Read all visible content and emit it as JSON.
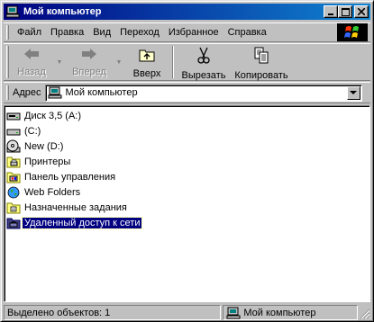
{
  "window": {
    "title": "Мой компьютер",
    "buttons": {
      "minimize": "_",
      "maximize": "□",
      "close": "×"
    }
  },
  "menubar": {
    "items": [
      {
        "id": "file",
        "label": "Файл"
      },
      {
        "id": "edit",
        "label": "Правка"
      },
      {
        "id": "view",
        "label": "Вид"
      },
      {
        "id": "go",
        "label": "Переход"
      },
      {
        "id": "favorites",
        "label": "Избранное"
      },
      {
        "id": "help",
        "label": "Справка"
      }
    ]
  },
  "toolbar": {
    "back": {
      "label": "Назад",
      "icon": "back-arrow-icon",
      "enabled": false
    },
    "forward": {
      "label": "Вперед",
      "icon": "forward-arrow-icon",
      "enabled": false
    },
    "up": {
      "label": "Вверх",
      "icon": "up-folder-icon",
      "enabled": true
    },
    "cut": {
      "label": "Вырезать",
      "icon": "scissors-icon",
      "enabled": true
    },
    "copy": {
      "label": "Копировать",
      "icon": "copy-icon",
      "enabled": true
    }
  },
  "address": {
    "label": "Адрес",
    "value": "Мой компьютер",
    "icon": "my-computer-icon"
  },
  "items": [
    {
      "label": "Диск 3,5 (A:)",
      "icon": "floppy-drive-icon",
      "selected": false
    },
    {
      "label": "(C:)",
      "icon": "hard-drive-icon",
      "selected": false
    },
    {
      "label": "New (D:)",
      "icon": "cd-drive-icon",
      "selected": false
    },
    {
      "label": "Принтеры",
      "icon": "printers-folder-icon",
      "selected": false
    },
    {
      "label": "Панель управления",
      "icon": "control-panel-icon",
      "selected": false
    },
    {
      "label": "Web Folders",
      "icon": "web-folders-icon",
      "selected": false
    },
    {
      "label": "Назначенные задания",
      "icon": "scheduled-tasks-icon",
      "selected": false
    },
    {
      "label": "Удаленный доступ к сети",
      "icon": "dialup-networking-icon",
      "selected": true
    }
  ],
  "statusbar": {
    "selection": "Выделено объектов: 1",
    "location": "Мой компьютер"
  },
  "colors": {
    "titlebar_start": "#000080",
    "titlebar_end": "#1084d0",
    "face": "#c0c0c0",
    "selection": "#000080"
  }
}
